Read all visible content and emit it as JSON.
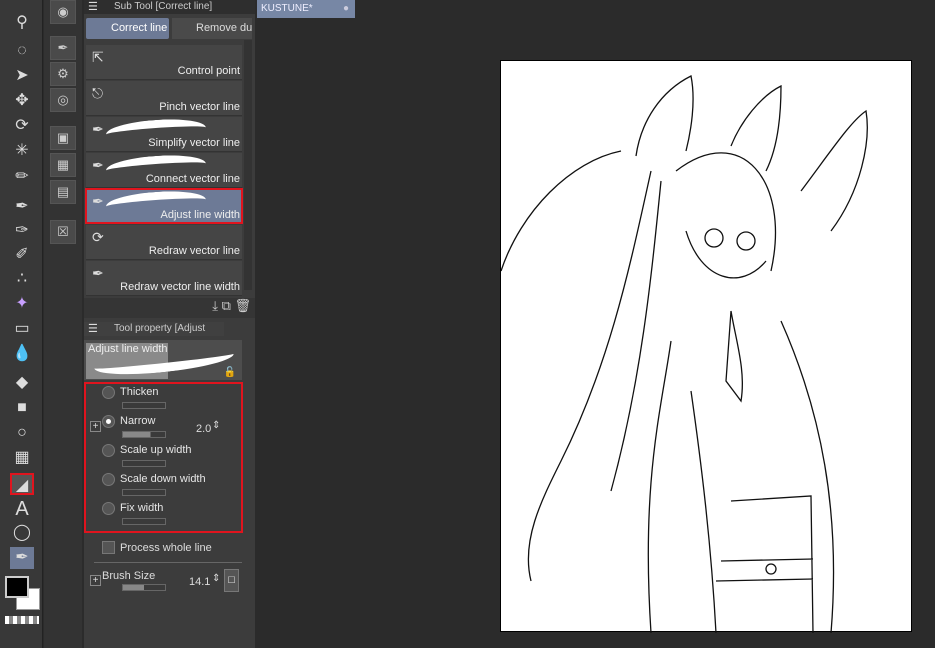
{
  "document_tab": {
    "title": "KUSTUNE*"
  },
  "subtool": {
    "header": "Sub Tool [Correct line]",
    "groups": [
      "Correct line",
      "Remove du"
    ],
    "items": [
      {
        "label": "Control point",
        "icon": "control-point-icon"
      },
      {
        "label": "Pinch vector line",
        "icon": "pinch-icon"
      },
      {
        "label": "Simplify vector line",
        "icon": "brush-icon"
      },
      {
        "label": "Connect vector line",
        "icon": "brush-icon"
      },
      {
        "label": "Adjust line width",
        "icon": "brush-icon",
        "selected": true
      },
      {
        "label": "Redraw vector line",
        "icon": "redraw-icon"
      },
      {
        "label": "Redraw vector line width",
        "icon": "redraw-width-icon"
      }
    ]
  },
  "tool_property": {
    "header": "Tool property [Adjust",
    "preview_label": "Adjust line width",
    "options": [
      {
        "label": "Thicken",
        "selected": false
      },
      {
        "label": "Narrow",
        "selected": true,
        "value": "2.0"
      },
      {
        "label": "Scale up width",
        "selected": false
      },
      {
        "label": "Scale down width",
        "selected": false
      },
      {
        "label": "Fix width",
        "selected": false
      }
    ],
    "process_whole_line": "Process whole line",
    "brush_size_label": "Brush Size",
    "brush_size_value": "14.1"
  },
  "colors": {
    "accent": "#6d7a96",
    "highlight": "#e0141e"
  }
}
